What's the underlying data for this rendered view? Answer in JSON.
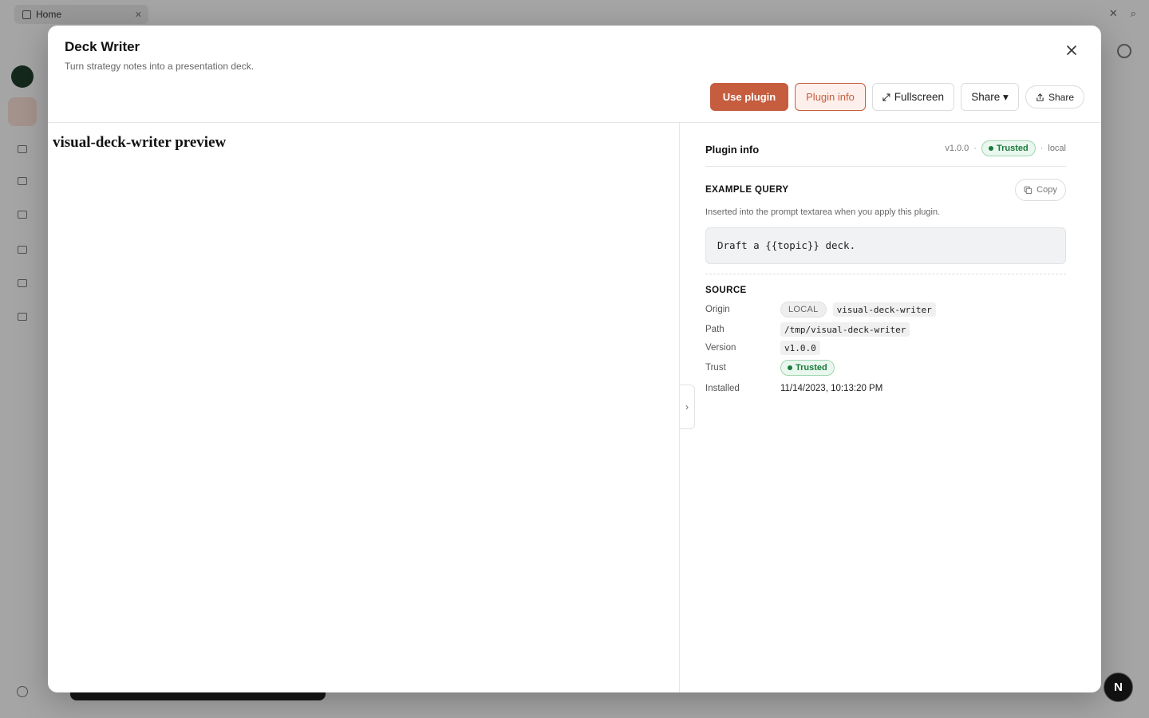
{
  "background": {
    "tab_label": "Home"
  },
  "modal": {
    "title": "Deck Writer",
    "subtitle": "Turn strategy notes into a presentation deck.",
    "actions": {
      "use_plugin": "Use plugin",
      "plugin_info": "Plugin info",
      "fullscreen": "Fullscreen",
      "share_dropdown": "Share ▾",
      "share": "Share"
    }
  },
  "preview": {
    "title": "visual-deck-writer preview",
    "collapse_glyph": "›"
  },
  "info": {
    "title": "Plugin info",
    "version": "v1.0.0",
    "separator": "·",
    "trust_label": "Trusted",
    "scope": "local",
    "example_query": {
      "label": "EXAMPLE QUERY",
      "copy_label": "Copy",
      "description": "Inserted into the prompt textarea when you apply this plugin.",
      "query": "Draft a {{topic}} deck."
    },
    "source": {
      "label": "SOURCE",
      "origin_key": "Origin",
      "origin_type": "LOCAL",
      "origin_name": "visual-deck-writer",
      "path_key": "Path",
      "path": "/tmp/visual-deck-writer",
      "version_key": "Version",
      "version": "v1.0.0",
      "trust_key": "Trust",
      "trust": "Trusted",
      "installed_key": "Installed",
      "installed": "11/14/2023, 10:13:20 PM"
    }
  },
  "corner_badge": "N",
  "colors": {
    "accent": "#c65d3e",
    "trusted": "#1a7a3c"
  }
}
